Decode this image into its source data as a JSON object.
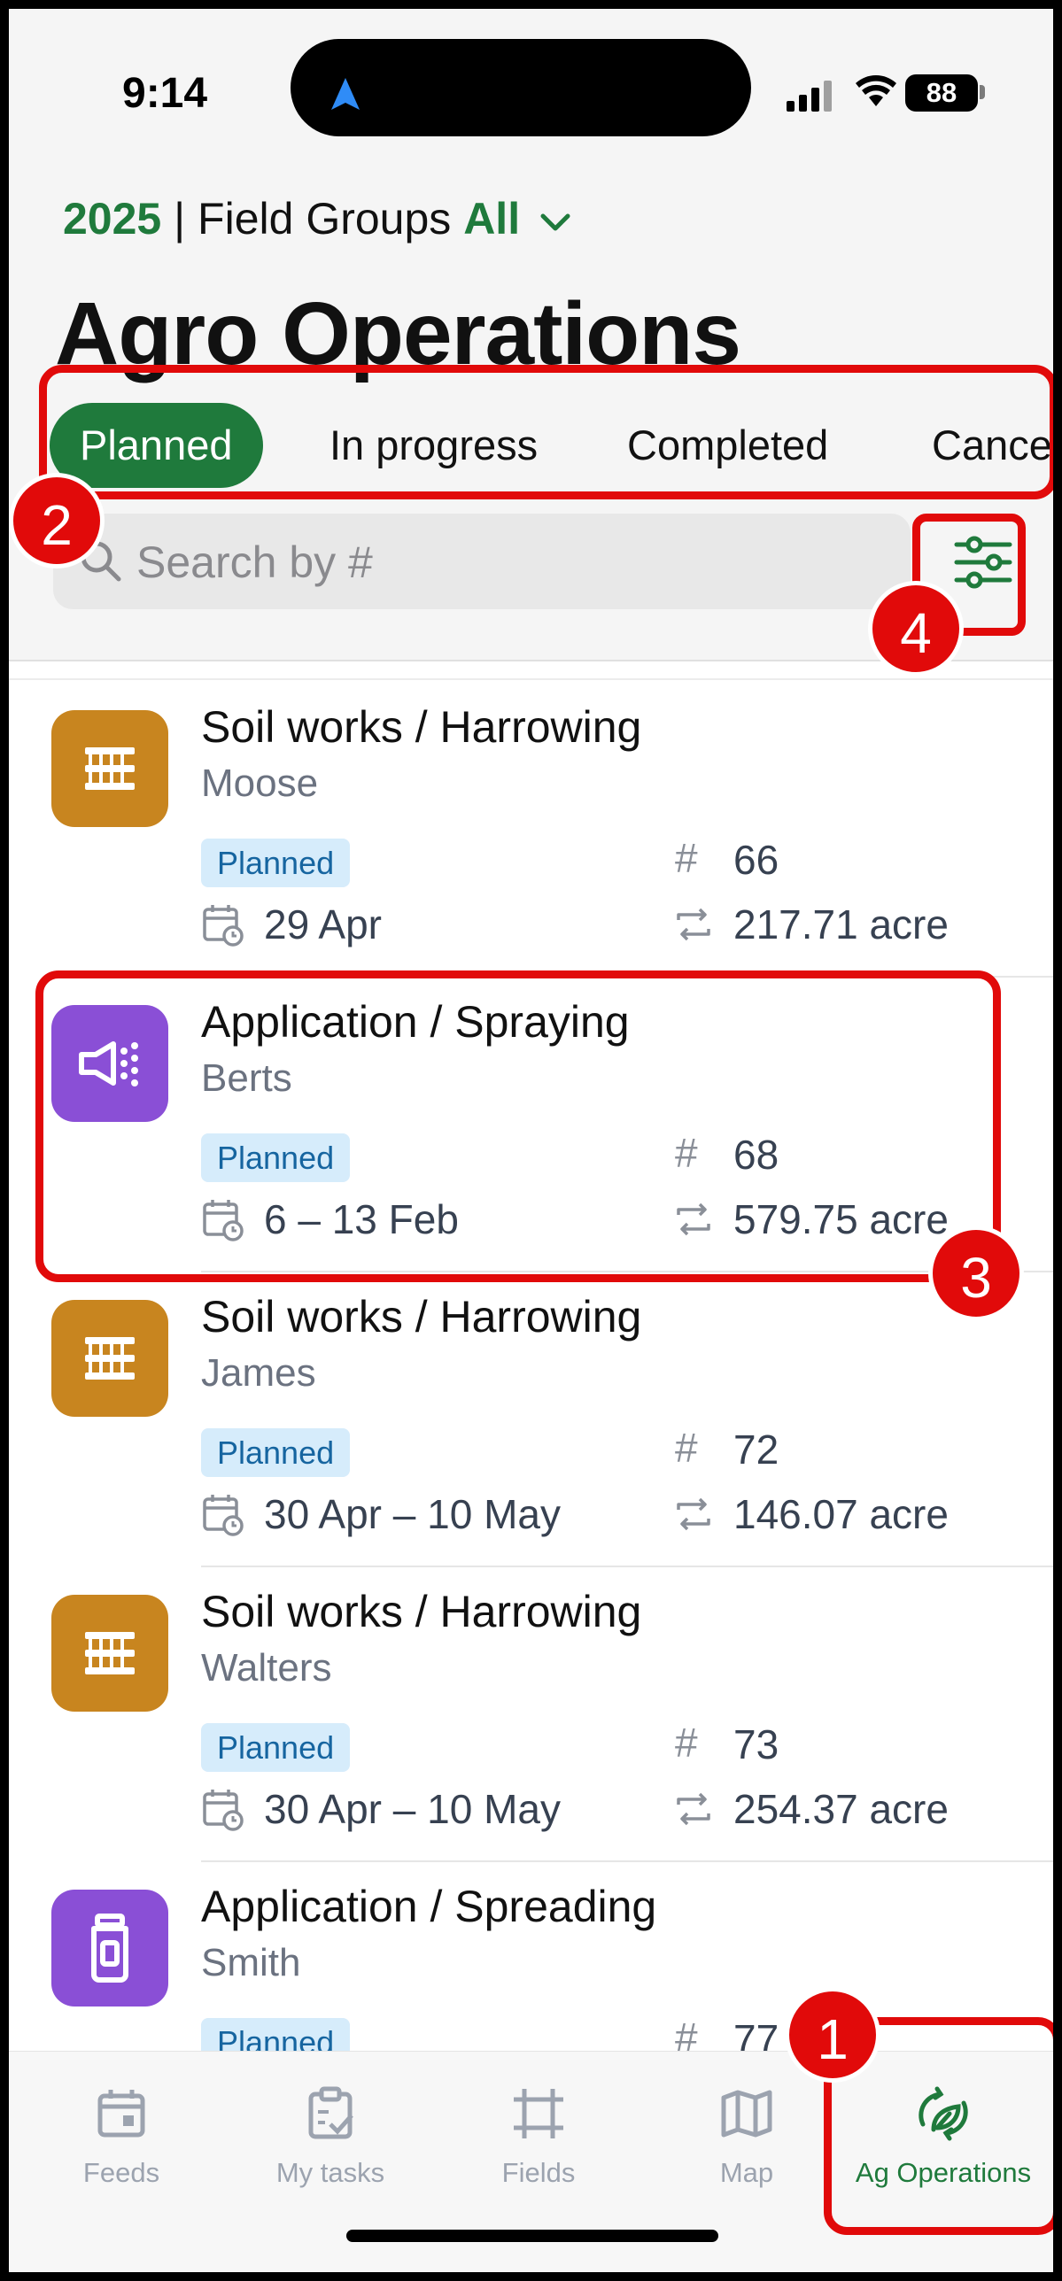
{
  "status": {
    "time": "9:14",
    "battery": "88"
  },
  "header": {
    "year": "2025",
    "separator": "|",
    "field_groups_label": "Field Groups",
    "field_groups_value": "All"
  },
  "title": "Agro Operations",
  "tabs": [
    {
      "label": "Planned",
      "active": true
    },
    {
      "label": "In progress",
      "active": false
    },
    {
      "label": "Completed",
      "active": false
    },
    {
      "label": "Cance",
      "active": false
    }
  ],
  "search": {
    "placeholder": "Search by #"
  },
  "operations": [
    {
      "name": "Soil works / Harrowing",
      "person": "Moose",
      "status": "Planned",
      "hash": "#",
      "number": "66",
      "date": "29 Apr",
      "area": "217.71 acre",
      "icon": "harrow-icon",
      "color": "#c8851f"
    },
    {
      "name": "Application / Spraying",
      "person": "Berts",
      "status": "Planned",
      "hash": "#",
      "number": "68",
      "date": "6 – 13 Feb",
      "area": "579.75 acre",
      "icon": "sprayer-icon",
      "color": "#8a4fd6"
    },
    {
      "name": "Soil works / Harrowing",
      "person": "James",
      "status": "Planned",
      "hash": "#",
      "number": "72",
      "date": "30 Apr – 10 May",
      "area": "146.07 acre",
      "icon": "harrow-icon",
      "color": "#c8851f"
    },
    {
      "name": "Soil works / Harrowing",
      "person": "Walters",
      "status": "Planned",
      "hash": "#",
      "number": "73",
      "date": "30 Apr – 10 May",
      "area": "254.37 acre",
      "icon": "harrow-icon",
      "color": "#c8851f"
    },
    {
      "name": "Application / Spreading",
      "person": "Smith",
      "status": "Planned",
      "hash": "#",
      "number": "77",
      "date": "",
      "area": "",
      "icon": "spreader-icon",
      "color": "#8a4fd6"
    }
  ],
  "tabbar": [
    {
      "label": "Feeds",
      "icon": "calendar-icon",
      "active": false
    },
    {
      "label": "My tasks",
      "icon": "clipboard-check-icon",
      "active": false
    },
    {
      "label": "Fields",
      "icon": "field-frame-icon",
      "active": false
    },
    {
      "label": "Map",
      "icon": "map-icon",
      "active": false
    },
    {
      "label": "Ag Operations",
      "icon": "ag-operations-icon",
      "active": true
    }
  ],
  "annotations": [
    "1",
    "2",
    "3",
    "4"
  ],
  "colors": {
    "brand_green": "#1f7a3c",
    "annotation_red": "#e10a0a",
    "badge_bg": "#d6ecfb",
    "badge_text": "#1665a0"
  }
}
